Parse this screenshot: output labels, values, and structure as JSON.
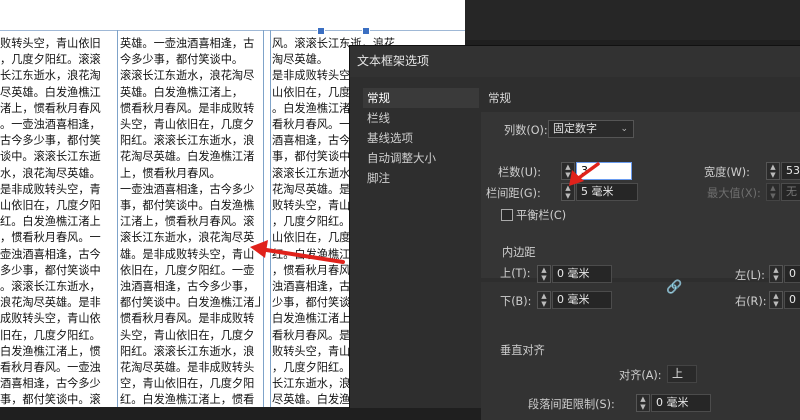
{
  "document": {
    "column1": [
      "败转头空，青山依旧",
      "，几度夕阳红。滚滚",
      "长江东逝水，浪花淘",
      "尽英雄。白发渔樵江",
      "渚上，惯看秋月春风",
      "。一壶浊酒喜相逢，",
      "古今多少事，都付笑",
      "谈中。滚滚长江东逝",
      "水，浪花淘尽英雄。",
      "是非成败转头空，青",
      "山依旧在，几度夕阳",
      "红。白发渔樵江渚上",
      "，惯看秋月春风。一",
      "壶浊酒喜相逢，古今",
      "多少事，都付笑谈中",
      "。滚滚长江东逝水，",
      "浪花淘尽英雄。是非",
      "成败转头空，青山依",
      "旧在，几度夕阳红。",
      "白发渔樵江渚上，惯",
      "看秋月春风。一壶浊",
      "酒喜相逢，古今多少",
      "事，都付笑谈中。滚",
      "滚长江东逝水，浪花",
      "淘尽英雄。"
    ],
    "column2": [
      "英雄。一壶浊酒喜相逢，古",
      "今多少事，都付笑谈中。",
      "滚滚长江东逝水，浪花淘尽",
      "英雄。白发渔樵江渚上，",
      "惯看秋月春风。是非成败转",
      "头空，青山依旧在，几度夕",
      "阳红。滚滚长江东逝水，浪",
      "花淘尽英雄。白发渔樵江渚",
      "上，惯看秋月春风。",
      "一壶浊酒喜相逢，古今多少",
      "事，都付笑谈中。白发渔樵",
      "江渚上，惯看秋月春风。滚",
      "滚长江东逝水，浪花淘尽英",
      "雄。是非成败转头空，青山",
      "依旧在，几度夕阳红。一壶",
      "浊酒喜相逢，古今多少事，",
      "都付笑谈中。白发渔樵江渚上，",
      "惯看秋月春风。是非成败转",
      "头空，青山依旧在，几度夕",
      "阳红。滚滚长江东逝水，浪",
      "花淘尽英雄。是非成败转头",
      "空，青山依旧在，几度夕阳",
      "红。白发渔樵江渚上，惯看",
      "秋月春风。一壶浊酒喜相逢",
      "，古今多少事，都付笑谈中。"
    ],
    "column3": [
      "风。滚滚长江东逝，浪花",
      "淘尽英雄。",
      "是非成败转头空，青",
      "山依旧在，几度夕阳红",
      "。白发渔樵江渚上，惯",
      "看秋月春风。一壶浊",
      "酒喜相逢，古今多少",
      "事，都付笑谈中。",
      "滚滚长江东逝水，浪",
      "花淘尽英雄。是非成",
      "败转头空，青山依旧在",
      "，几度夕阳红。",
      "山依旧在，几度夕阳",
      "红。白发渔樵江渚上",
      "，惯看秋月春风。一壶",
      "浊酒喜相逢，古今多",
      "少事，都付笑谈中。",
      "白发渔樵江渚上，惯",
      "看秋月春风。是非成",
      "败转头空，青山依旧在",
      "，几度夕阳红。滚滚",
      "长江东逝水，浪花淘",
      "尽英雄。白发渔樵江",
      "渚上，惯看秋月春风",
      "。一壶浊酒喜相逢。"
    ]
  },
  "dialog": {
    "title": "文本框架选项",
    "nav": [
      "常规",
      "栏线",
      "基线选项",
      "自动调整大小",
      "脚注"
    ],
    "panel_title": "常规",
    "columns": {
      "label": "列数(O):",
      "value": "固定数字",
      "count_label": "栏数(U):",
      "count_value": "3",
      "width_label": "宽度(W):",
      "width_value": "53",
      "gutter_label": "栏间距(G):",
      "gutter_value": "5 毫米",
      "max_label": "最大值(X):",
      "max_value": "无",
      "balance_label": "平衡栏(C)"
    },
    "inset": {
      "title": "内边距",
      "top_label": "上(T):",
      "top_value": "0 毫米",
      "bottom_label": "下(B):",
      "bottom_value": "0 毫米",
      "left_label": "左(L):",
      "left_value": "0",
      "right_label": "右(R):",
      "right_value": "0"
    },
    "vertical": {
      "title": "垂直对齐",
      "align_label": "对齐(A):",
      "align_value": "上",
      "spacing_label": "段落间距限制(S):",
      "spacing_value": "0 毫米"
    }
  },
  "colors": {
    "arrow": "#e0221b",
    "dialog_bg": "#2e2e2e",
    "guide": "#7fa3c9"
  }
}
